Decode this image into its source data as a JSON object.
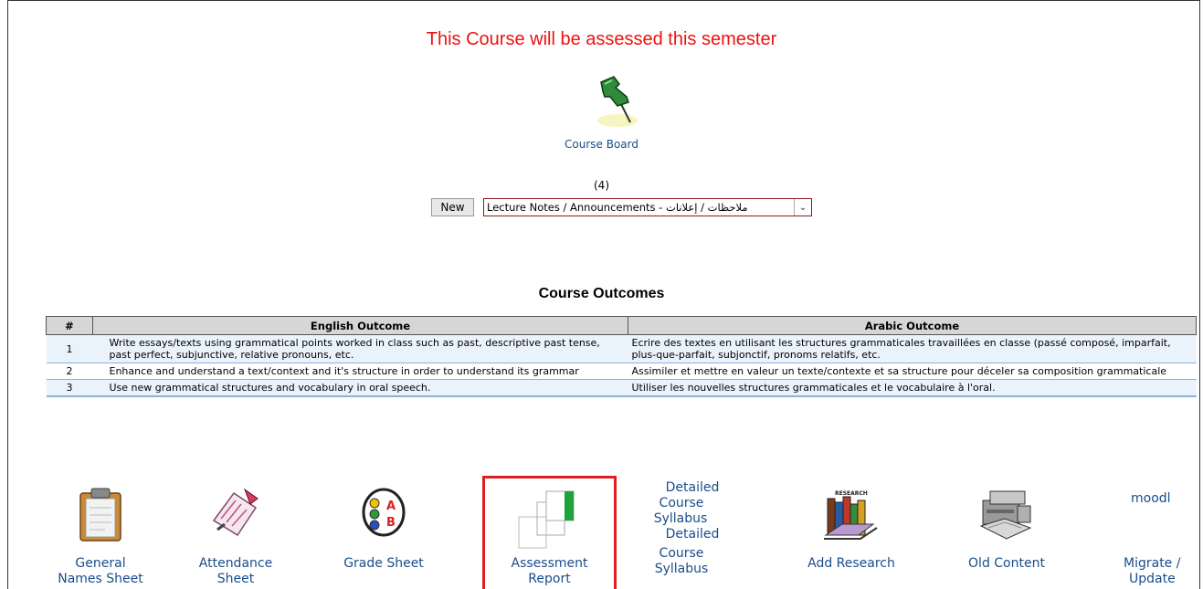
{
  "notice": "This Course will be assessed this semester",
  "course_board": {
    "label": "Course Board",
    "icon": "pushpin-icon"
  },
  "announcements": {
    "count": "(4)",
    "new_label": "New",
    "select_value": "Lecture Notes / Announcements - ملاحظات / إعلانات"
  },
  "outcomes": {
    "title": "Course Outcomes",
    "headers": [
      "#",
      "English Outcome",
      "Arabic Outcome"
    ],
    "rows": [
      {
        "num": "1",
        "english": "Write essays/texts using grammatical points worked in class such as past, descriptive past tense, past perfect, subjunctive, relative pronouns, etc.",
        "arabic": "Ecrire des textes en utilisant les structures grammaticales travaillées en classe (passé composé, imparfait, plus-que-parfait, subjonctif, pronoms relatifs, etc."
      },
      {
        "num": "2",
        "english": "Enhance and understand a text/context and it's structure in order to understand its grammar",
        "arabic": "Assimiler et mettre en valeur un texte/contexte et sa structure pour déceler sa composition grammaticale"
      },
      {
        "num": "3",
        "english": "Use new grammatical structures and vocabulary in oral speech.",
        "arabic": "Utiliser les nouvelles structures grammaticales et le vocabulaire à l'oral."
      }
    ]
  },
  "tiles": {
    "general_names": {
      "label1": "General",
      "label2": "Names Sheet",
      "icon": "clipboard-icon"
    },
    "attendance": {
      "label1": "Attendance",
      "label2": "Sheet",
      "icon": "attendance-icon"
    },
    "grade_sheet": {
      "label": "Grade Sheet",
      "icon": "grade-abc-icon"
    },
    "assessment": {
      "label1": "Assessment",
      "label2": "Report",
      "icon": "assessment-report-icon"
    },
    "syllabus": {
      "line1": "Detailed",
      "line2": "Course",
      "line3": "Syllabus",
      "line4": "Detailed",
      "line5": "Course",
      "line6": "Syllabus"
    },
    "research": {
      "label": "Add Research",
      "icon": "books-icon",
      "icon_text": "RESEARCH"
    },
    "old_content": {
      "label": "Old Content",
      "icon": "archive-icon"
    },
    "moodle": {
      "top": "moodl",
      "label1": "Migrate /",
      "label2": "Update"
    }
  },
  "colors": {
    "notice": "#ee1111",
    "link": "#1a4d8c",
    "highlight": "#e02020",
    "row_alt": "#eaf2fb"
  }
}
